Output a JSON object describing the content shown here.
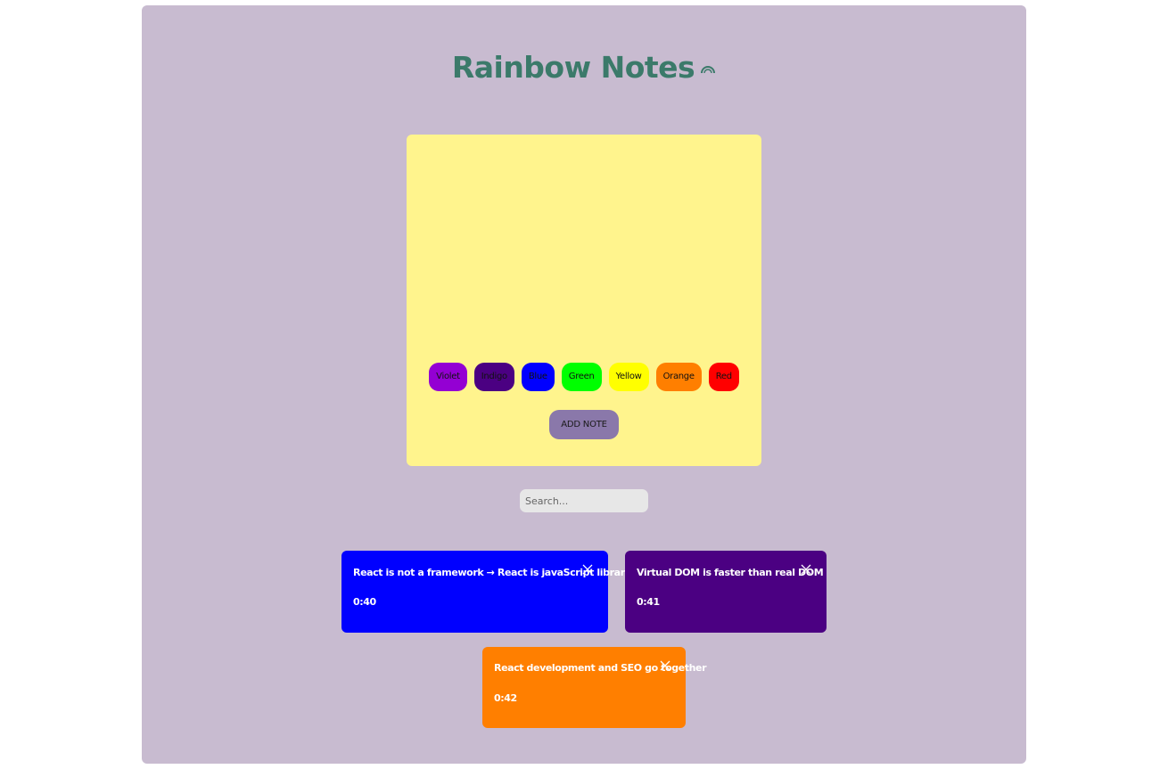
{
  "app": {
    "title": "Rainbow Notes",
    "title_icon": "rainbow-icon",
    "title_color": "#3b7a6a",
    "background": "#c8bbd0"
  },
  "composer": {
    "background": "#fff48d",
    "textarea_value": "",
    "add_label": "ADD NOTE",
    "add_color": "#8a78aa",
    "colors": [
      {
        "label": "Violet",
        "color": "#9400d3"
      },
      {
        "label": "Indigo",
        "color": "#4b0082"
      },
      {
        "label": "Blue",
        "color": "#0000ff"
      },
      {
        "label": "Green",
        "color": "#00ff00"
      },
      {
        "label": "Yellow",
        "color": "#ffff00"
      },
      {
        "label": "Orange",
        "color": "#ff7f00"
      },
      {
        "label": "Red",
        "color": "#ff0000"
      }
    ]
  },
  "search": {
    "placeholder": "Search...",
    "value": ""
  },
  "notes": [
    {
      "text": "React is not a framework → React is javaScript library.",
      "time": "0:40",
      "color": "#0000ff",
      "close_icon": "close-icon"
    },
    {
      "text": "Virtual DOM is faster than real DOM",
      "time": "0:41",
      "color": "#4b0082",
      "close_icon": "close-icon"
    },
    {
      "text": "React development and SEO go together",
      "time": "0:42",
      "color": "#ff7f00",
      "close_icon": "close-icon"
    }
  ]
}
